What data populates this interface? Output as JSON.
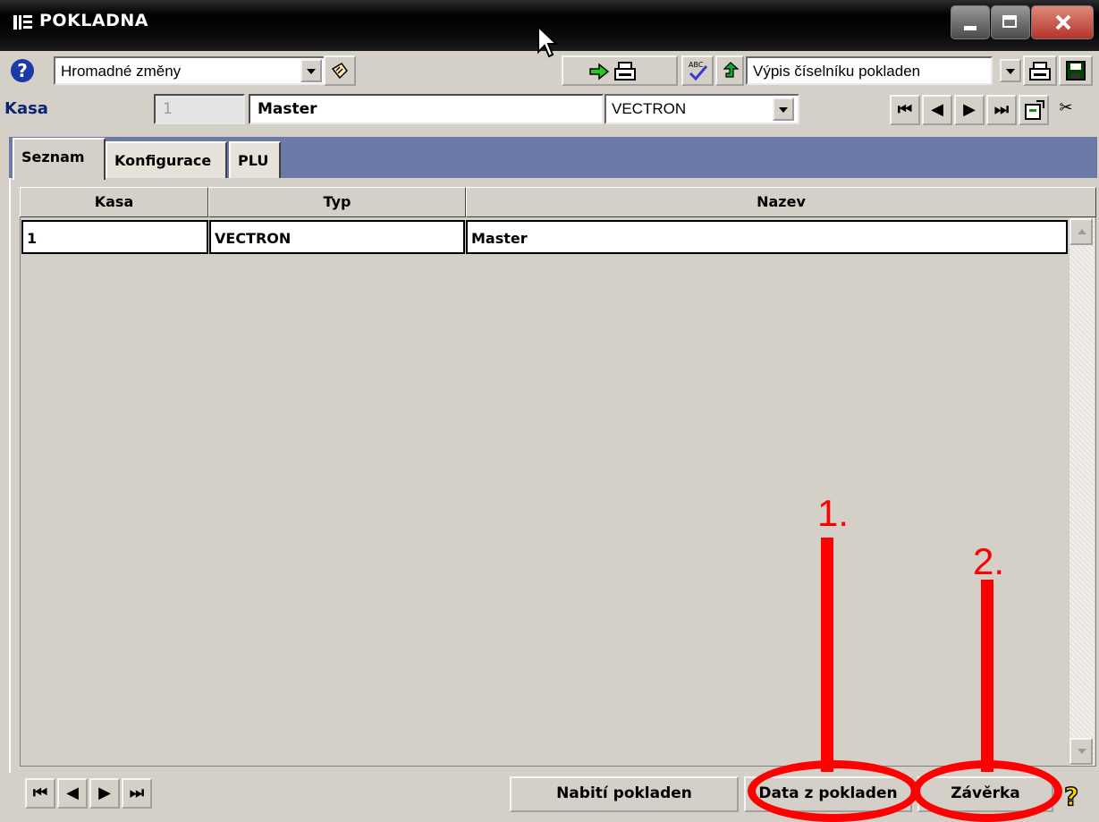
{
  "window": {
    "title": "POKLADNA",
    "title_icon": "app-icon"
  },
  "toolbar": {
    "help_label": "?",
    "action_select_value": "Hromadné změny",
    "report_select_value": "Výpis číselníku pokladen"
  },
  "record": {
    "label": "Kasa",
    "number": "1",
    "name": "Master",
    "type_value": "VECTRON"
  },
  "tabs": [
    {
      "label": "Seznam",
      "active": true
    },
    {
      "label": "Konfigurace",
      "active": false
    },
    {
      "label": "PLU",
      "active": false
    }
  ],
  "table": {
    "columns": [
      "Kasa",
      "Typ",
      "Nazev"
    ],
    "rows": [
      [
        "1",
        "VECTRON",
        "Master"
      ]
    ]
  },
  "bottom_bar": {
    "load_button": "Nabití pokladen",
    "data_button": "Data z pokladen",
    "close_button": "Závěrka"
  },
  "annotations": {
    "marker_1": "1.",
    "marker_2": "2.",
    "color": "#ff0000"
  },
  "colors": {
    "tab_band": "#6b7aa6",
    "window_face": "#d4d0c8",
    "label_blue": "#0b2470"
  }
}
